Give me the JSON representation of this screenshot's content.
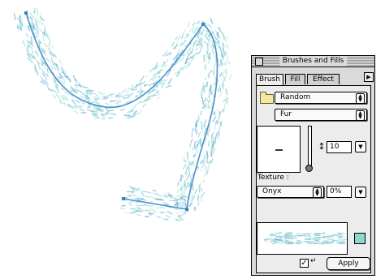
{
  "panel": {
    "title": "Brushes and Fills",
    "tabs": [
      {
        "label": "Brush",
        "active": true
      },
      {
        "label": "Fill",
        "active": false
      },
      {
        "label": "Effect",
        "active": false
      }
    ],
    "brush_category": "Random",
    "brush_name": "Fur",
    "size_value": "10",
    "texture_label": "Texture :",
    "texture_value": "Onyx",
    "texture_amount": "0%",
    "apply_label": "Apply",
    "apply_checked": true,
    "swatch_color": "#8fd6cf"
  },
  "icons": [
    "close-box-icon",
    "folder-icon",
    "tab-menu-arrow-icon",
    "popup-arrows-icon",
    "size-arrow-icon",
    "return-key-icon"
  ],
  "colors": {
    "stroke_path": "#4a92c8",
    "fur_primary": "#8fd6cf",
    "fur_secondary": "#7fbfe0"
  }
}
